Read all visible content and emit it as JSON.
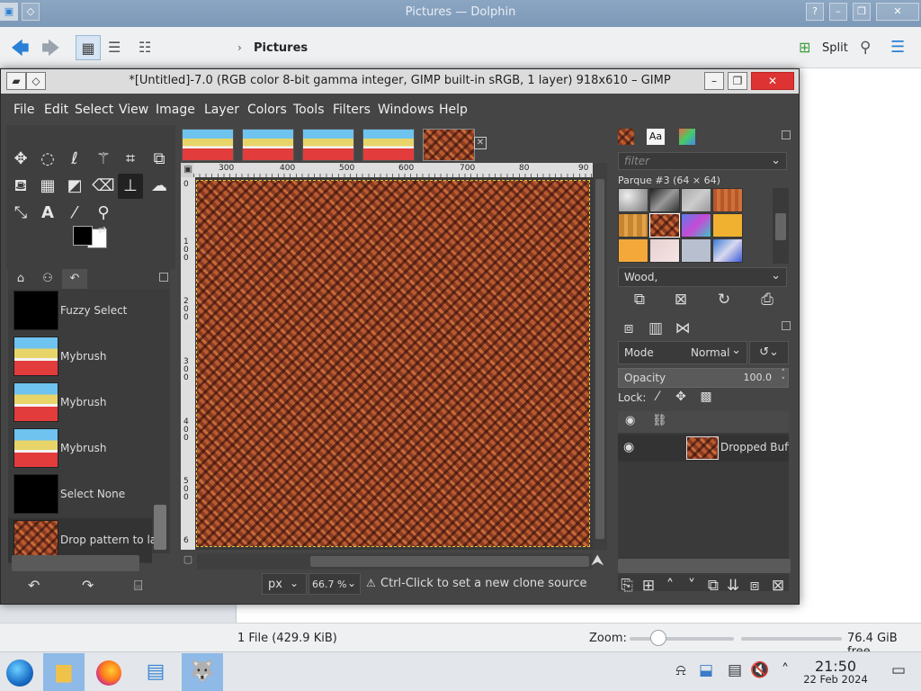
{
  "dolphin": {
    "title": "Pictures — Dolphin",
    "breadcrumb": "Pictures",
    "split_label": "Split",
    "status_files": "1 File (429.9 KiB)",
    "zoom_label": "Zoom:",
    "free_space": "76.4 GiB free"
  },
  "gimp": {
    "title": "*[Untitled]-7.0 (RGB color 8-bit gamma integer, GIMP built-in sRGB, 1 layer) 918x610 – GIMP",
    "menu": [
      "File",
      "Edit",
      "Select",
      "View",
      "Image",
      "Layer",
      "Colors",
      "Tools",
      "Filters",
      "Windows",
      "Help"
    ],
    "undo_history": [
      {
        "label": "Fuzzy Select"
      },
      {
        "label": "Mybrush"
      },
      {
        "label": "Mybrush"
      },
      {
        "label": "Mybrush"
      },
      {
        "label": "Select None"
      },
      {
        "label": "Drop pattern to lay"
      }
    ],
    "ruler_h_ticks": [
      "300",
      "400",
      "500",
      "600",
      "700",
      "80",
      "90"
    ],
    "ruler_v_ticks": [
      "0",
      "1\n0\n0",
      "2\n0\n0",
      "3\n0\n0",
      "4\n0\n0",
      "5\n0\n0",
      "6"
    ],
    "unit": "px",
    "zoom": "66.7 %",
    "status_hint": "Ctrl-Click to set a new clone source",
    "patterns": {
      "filter_placeholder": "filter",
      "current": "Parque #3 (64 × 64)",
      "tag": "Wood,",
      "font_tab": "Aa"
    },
    "layers": {
      "mode_label": "Mode",
      "mode_value": "Normal",
      "opacity_label": "Opacity",
      "opacity_value": "100.0",
      "lock_label": "Lock:",
      "layer_name": "Dropped Buffe"
    }
  },
  "taskbar": {
    "clock_time": "21:50",
    "clock_date": "22 Feb 2024"
  },
  "colors": {
    "accent": "#2980d6",
    "gimp_bg": "#454545",
    "wood": "#9a4426"
  }
}
